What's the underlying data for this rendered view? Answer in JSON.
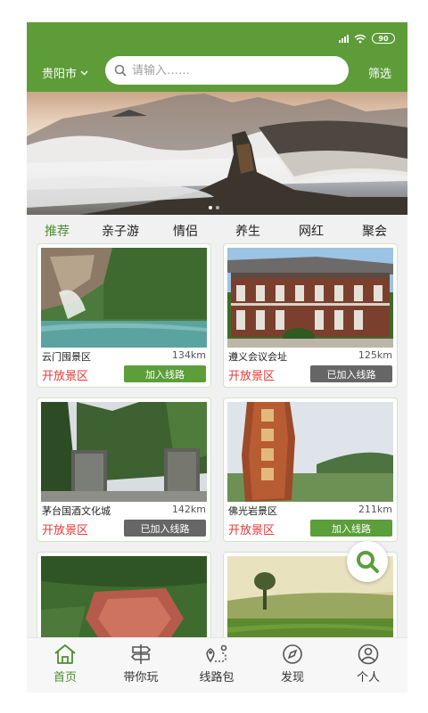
{
  "status_bar": {
    "battery": "90"
  },
  "header": {
    "city": "贵阳市",
    "search_placeholder": "请输入……",
    "filter_label": "筛选"
  },
  "banner": {
    "dots": 2,
    "active_dot": 0
  },
  "tabs": [
    {
      "label": "推荐",
      "active": true
    },
    {
      "label": "亲子游",
      "active": false
    },
    {
      "label": "情侣",
      "active": false
    },
    {
      "label": "养生",
      "active": false
    },
    {
      "label": "网红",
      "active": false
    },
    {
      "label": "聚会",
      "active": false
    }
  ],
  "cards": [
    {
      "name": "云门囤景区",
      "distance": "134km",
      "status": "开放景区",
      "button": "加入线路",
      "added": false
    },
    {
      "name": "遵义会议会址",
      "distance": "125km",
      "status": "开放景区",
      "button": "已加入线路",
      "added": true
    },
    {
      "name": "茅台国酒文化城",
      "distance": "142km",
      "status": "开放景区",
      "button": "已加入线路",
      "added": true
    },
    {
      "name": "佛光岩景区",
      "distance": "211km",
      "status": "开放景区",
      "button": "加入线路",
      "added": false
    },
    {
      "name": "",
      "distance": "",
      "status": "",
      "button": "",
      "added": false
    },
    {
      "name": "",
      "distance": "",
      "status": "",
      "button": "",
      "added": false
    }
  ],
  "bottom_nav": [
    {
      "label": "首页",
      "icon": "home-icon",
      "active": true
    },
    {
      "label": "带你玩",
      "icon": "signpost-icon",
      "active": false
    },
    {
      "label": "线路包",
      "icon": "route-icon",
      "active": false
    },
    {
      "label": "发现",
      "icon": "compass-icon",
      "active": false
    },
    {
      "label": "个人",
      "icon": "person-icon",
      "active": false
    }
  ],
  "colors": {
    "brand": "#5d9c38",
    "alert": "#e53935",
    "added_button": "#666666"
  }
}
